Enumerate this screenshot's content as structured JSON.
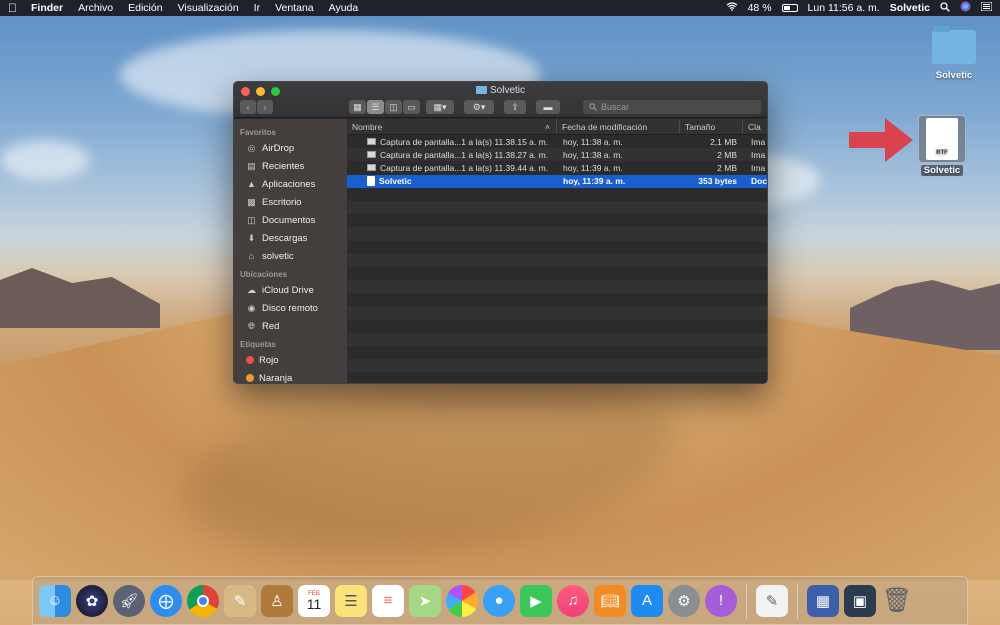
{
  "menubar": {
    "apple_icon": "apple-icon",
    "app_name": "Finder",
    "menus": [
      "Archivo",
      "Edición",
      "Visualización",
      "Ir",
      "Ventana",
      "Ayuda"
    ],
    "battery_text": "48 %",
    "clock": "Lun 11:56 a. m.",
    "user": "Solvetic"
  },
  "desktop": {
    "folder_label": "Solvetic",
    "file_label": "Solvetic",
    "file_badge": "RTF"
  },
  "finder": {
    "title": "Solvetic",
    "search_placeholder": "Buscar",
    "sidebar": {
      "favorites_heading": "Favoritos",
      "favorites": [
        "AirDrop",
        "Recientes",
        "Aplicaciones",
        "Escritorio",
        "Documentos",
        "Descargas",
        "solvetic"
      ],
      "locations_heading": "Ubicaciones",
      "locations": [
        "iCloud Drive",
        "Disco remoto",
        "Red"
      ],
      "tags_heading": "Etiquetas",
      "tags": [
        {
          "label": "Rojo",
          "color": "#e9524a"
        },
        {
          "label": "Naranja",
          "color": "#f09a37"
        }
      ]
    },
    "columns": {
      "name": "Nombre",
      "date": "Fecha de modificación",
      "size": "Tamaño",
      "kind": "Cla"
    },
    "files": [
      {
        "name": "Captura de pantalla...1 a la(s) 11.38.15 a. m.",
        "date": "hoy, 11:38 a. m.",
        "size": "2,1 MB",
        "kind": "Ima",
        "selected": false
      },
      {
        "name": "Captura de pantalla...1 a la(s) 11.38.27 a. m.",
        "date": "hoy, 11:38 a. m.",
        "size": "2 MB",
        "kind": "Ima",
        "selected": false
      },
      {
        "name": "Captura de pantalla...1 a la(s) 11.39.44 a. m.",
        "date": "hoy, 11:39 a. m.",
        "size": "2 MB",
        "kind": "Ima",
        "selected": false
      },
      {
        "name": "Solvetic",
        "date": "hoy, 11:39 a. m.",
        "size": "353 bytes",
        "kind": "Doc",
        "selected": true
      }
    ]
  },
  "colors": {
    "selection": "#1a5fd0",
    "arrow": "#d9434f"
  },
  "dock": {
    "calendar_month": "FEB",
    "calendar_day": "11"
  }
}
